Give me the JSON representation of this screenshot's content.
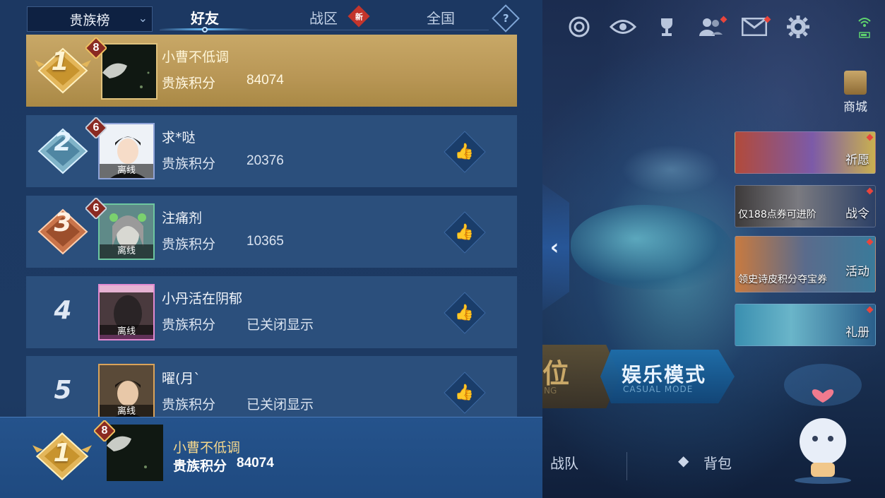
{
  "colors": {
    "gold": "#c8a867",
    "row_bg": "#2b4f7c",
    "panel_bg": "#1c3862",
    "self_bar": "#25538c",
    "red_dot": "#e8453c",
    "accent_blue": "#6ec3ff"
  },
  "leaderboard": {
    "dropdown_label": "贵族榜",
    "tabs": [
      {
        "label": "好友",
        "active": true
      },
      {
        "label": "战区",
        "badge": "新"
      },
      {
        "label": "全国"
      }
    ],
    "help_icon": "?",
    "rows": [
      {
        "rank": "1",
        "level": "8",
        "name": "小曹不低调",
        "score_label": "贵族积分",
        "score": "84074",
        "status": ""
      },
      {
        "rank": "2",
        "level": "6",
        "name": "求*哒",
        "score_label": "贵族积分",
        "score": "20376",
        "status": "离线"
      },
      {
        "rank": "3",
        "level": "6",
        "name": "注痛剂",
        "score_label": "贵族积分",
        "score": "10365",
        "status": "离线"
      },
      {
        "rank": "4",
        "level": "",
        "name": "小丹活在阴郁",
        "score_label": "贵族积分",
        "score": "已关闭显示",
        "status": "离线"
      },
      {
        "rank": "5",
        "level": "",
        "name": "曜(月`",
        "score_label": "贵族积分",
        "score": "已关闭显示",
        "status": "离线"
      }
    ],
    "self": {
      "rank": "1",
      "level": "8",
      "name": "小曹不低调",
      "score_label": "贵族积分",
      "score": "84074"
    }
  },
  "right": {
    "shop_label": "商城",
    "promos": [
      {
        "label": "祈愿",
        "sub": ""
      },
      {
        "label": "战令",
        "sub": "仅188点券可进阶"
      },
      {
        "label": "活动",
        "sub": "领史诗皮积分夺宝券"
      },
      {
        "label": "礼册",
        "sub": ""
      }
    ],
    "mode_rank": {
      "title": "位",
      "sub": "NG"
    },
    "mode_casual": {
      "title": "娱乐模式",
      "sub": "CASUAL MODE"
    },
    "nav": {
      "team": "战队",
      "bag": "背包"
    },
    "collapse_arrow": "‹"
  }
}
